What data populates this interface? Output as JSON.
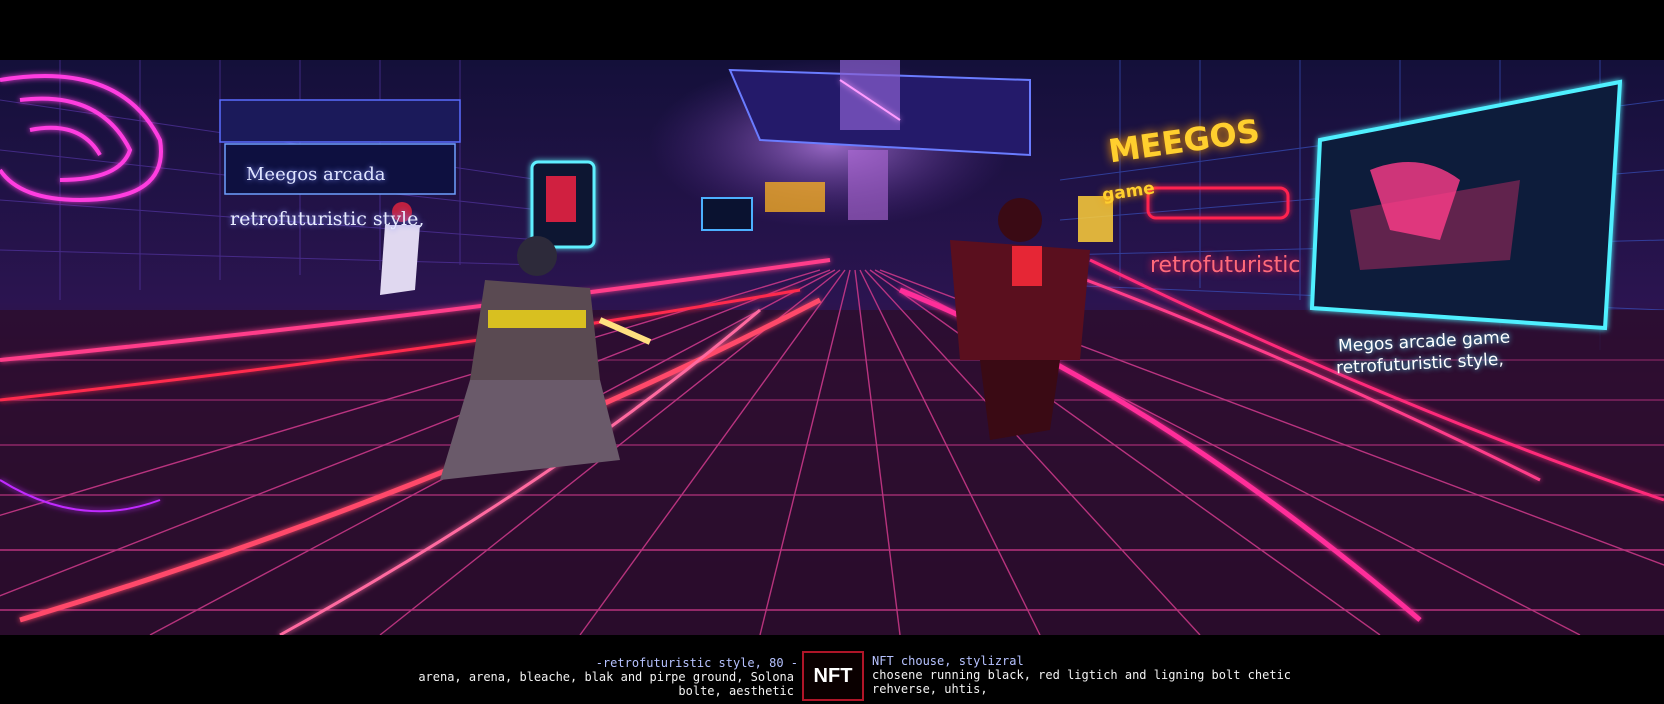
{
  "scene": {
    "signs": {
      "left_line1": "Meegos arcada",
      "left_line2": "retrofuturistic style,",
      "top_right_title": "MEEGOS",
      "top_right_sub": "game",
      "mid_right": "retrofuturistic",
      "screen_line1": "Megos arcade game",
      "screen_line2": "retrofuturistic style,"
    },
    "colors": {
      "neon_pink": "#ff2f9a",
      "neon_red": "#ff2a4d",
      "neon_cyan": "#47e6ff",
      "neon_yellow": "#ffcf2e",
      "floor_purple": "#3a0f3c"
    }
  },
  "caption": {
    "left_line1": "-retrofuturistic style, 80 -",
    "left_line2": "arena, arena, bleache, blak and pirpe ground, Solona",
    "left_line3": "bolte, aesthetic",
    "badge": "NFT",
    "right_line1": "NFT chouse, stylizral",
    "right_line2": "chosene running black, red ligtich and ligning bolt chetic",
    "right_line3": "rehverse, uhtis,"
  }
}
